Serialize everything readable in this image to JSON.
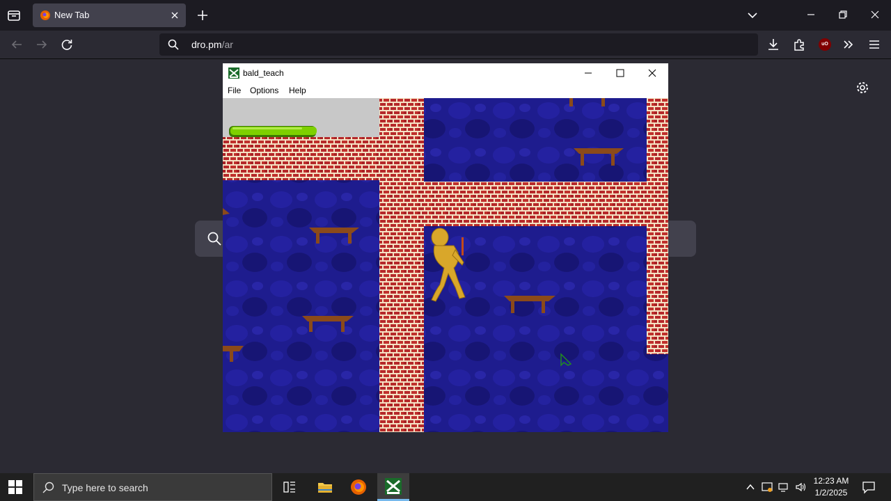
{
  "browser": {
    "tab": {
      "title": "New Tab"
    },
    "url": {
      "host": "dro.pm",
      "path": "/ar"
    }
  },
  "game_window": {
    "title": "bald_teach",
    "menu": [
      "File",
      "Options",
      "Help"
    ],
    "stamina_fill": 0.56
  },
  "taskbar": {
    "search_placeholder": "Type here to search",
    "time": "12:23 AM",
    "date": "1/2/2025"
  },
  "colors": {
    "brick_red": "#b5282a",
    "mortar": "#f5e2c4",
    "floor_blue": "#1e1c8e",
    "stamina_green": "#7ed000",
    "table_brown": "#8b4a1a",
    "character_yellow": "#d9a72a"
  }
}
